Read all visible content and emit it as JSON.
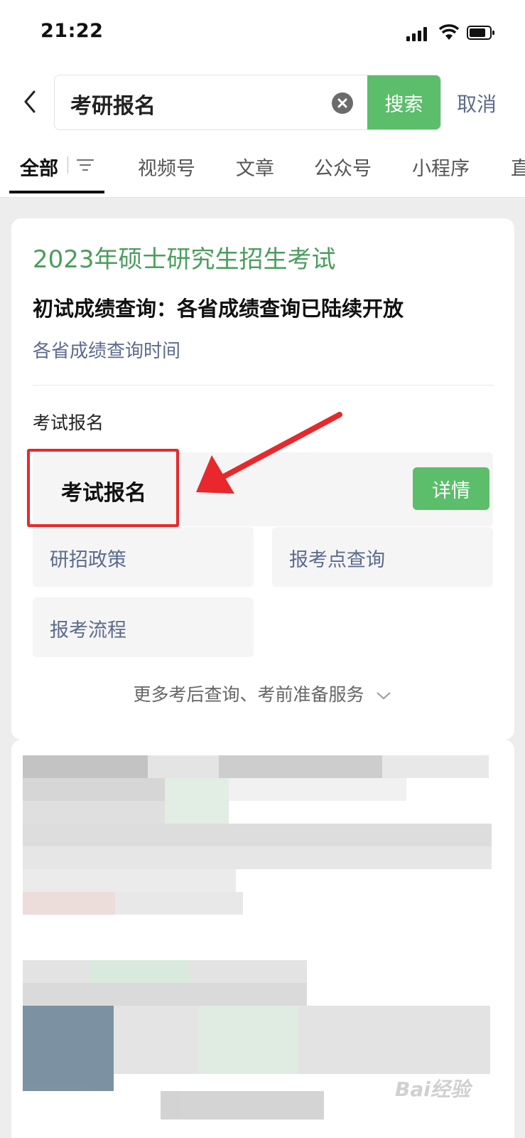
{
  "status_bar": {
    "time": "21:22"
  },
  "search": {
    "query": "考研报名",
    "search_label": "搜索",
    "cancel_label": "取消"
  },
  "tabs": [
    {
      "label": "全部",
      "active": true
    },
    {
      "label": "视频号"
    },
    {
      "label": "文章"
    },
    {
      "label": "公众号"
    },
    {
      "label": "小程序"
    },
    {
      "label": "直"
    }
  ],
  "card": {
    "title": "2023年硕士研究生招生考试",
    "subtitle": "初试成绩查询：各省成绩查询已陆续开放",
    "link": "各省成绩查询时间",
    "section_label": "考试报名",
    "main_item": {
      "label": "考试报名",
      "button": "详情"
    },
    "grid": [
      "研招政策",
      "报考点查询",
      "报考流程"
    ],
    "more": "更多考后查询、考前准备服务"
  },
  "colors": {
    "accent": "#5cbd6b",
    "title_green": "#4a9e5c",
    "link": "#5b6b8c",
    "annotation_red": "#e8282c"
  },
  "watermark": "Bai经验"
}
